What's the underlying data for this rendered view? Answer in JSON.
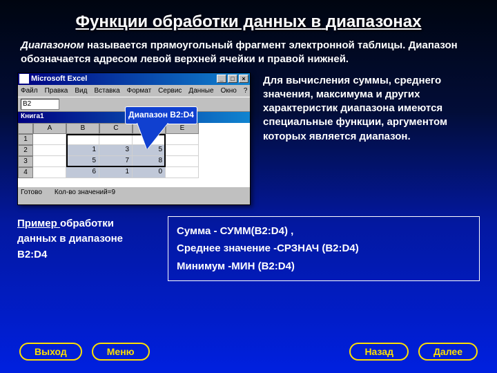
{
  "title": {
    "p1": "Функции обработки данных в",
    "p2": "диапазонах"
  },
  "intro": {
    "em": "Диапазоном",
    "rest": " называется прямоугольный фрагмент электронной таблицы. Диапазон обозначается адресом левой верхней ячейки и правой нижней."
  },
  "excel": {
    "app": "Microsoft Excel",
    "menus": [
      "Файл",
      "Правка",
      "Вид",
      "Вставка",
      "Формат",
      "Сервис",
      "Данные",
      "Окно",
      "?"
    ],
    "namebox": "B2",
    "book": "Книга1",
    "cols": [
      "A",
      "B",
      "C",
      "D",
      "E"
    ],
    "rows": [
      {
        "h": "1",
        "c": [
          "",
          "",
          "",
          "",
          ""
        ]
      },
      {
        "h": "2",
        "c": [
          "",
          "1",
          "3",
          "5",
          ""
        ]
      },
      {
        "h": "3",
        "c": [
          "",
          "5",
          "7",
          "8",
          ""
        ]
      },
      {
        "h": "4",
        "c": [
          "",
          "6",
          "1",
          "0",
          ""
        ]
      }
    ],
    "status1": "Готово",
    "status2": "Кол-во значений=9",
    "winbtns": [
      "_",
      "□",
      "×"
    ]
  },
  "callout": "Диапазон B2:D4",
  "righttext": "Для вычисления суммы, среднего значения, максимума и других характеристик  диапазона имеются специальные функции, аргументом которых является  диапазон.",
  "example": {
    "u": "Пример ",
    "rest": "обработки данных в диапазоне B2:D4"
  },
  "formulas": {
    "l1": "Сумма  -   СУММ(B2:D4) ,",
    "l2": "Среднее значение -СРЗНАЧ (B2:D4)",
    "l3": "Минимум -МИН (B2:D4)"
  },
  "nav": {
    "exit": "Выход",
    "menu": "Меню",
    "back": "Назад",
    "next": "Далее"
  }
}
